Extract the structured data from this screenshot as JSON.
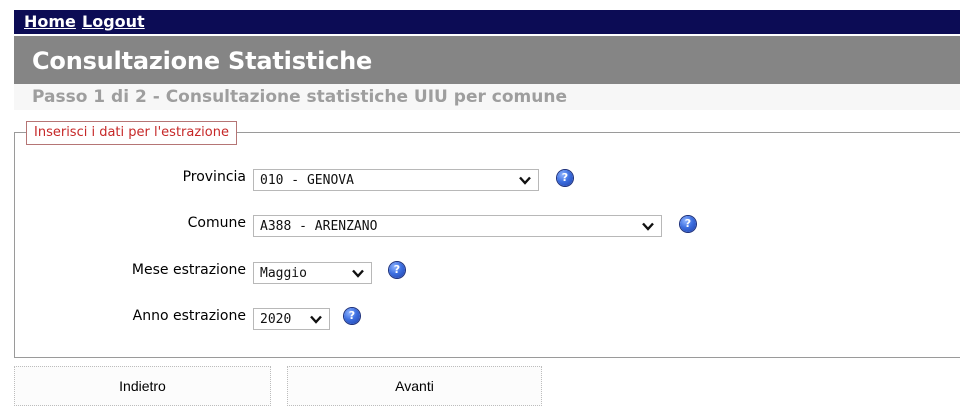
{
  "nav": {
    "home": "Home",
    "logout": "Logout"
  },
  "header": {
    "title": "Consultazione Statistiche",
    "step": "Passo 1 di 2 - Consultazione statistiche UIU per comune"
  },
  "form": {
    "legend": "Inserisci i dati per l'estrazione",
    "provincia": {
      "label": "Provincia",
      "value": "010 - GENOVA"
    },
    "comune": {
      "label": "Comune",
      "value": "A388 - ARENZANO"
    },
    "mese": {
      "label": "Mese estrazione",
      "value": "Maggio"
    },
    "anno": {
      "label": "Anno estrazione",
      "value": "2020"
    },
    "help_icon": "help-question-icon"
  },
  "buttons": {
    "back": "Indietro",
    "next": "Avanti"
  },
  "colors": {
    "topbar": "#0c0c55",
    "titlebar": "#858585",
    "legend_text": "#c62828"
  }
}
